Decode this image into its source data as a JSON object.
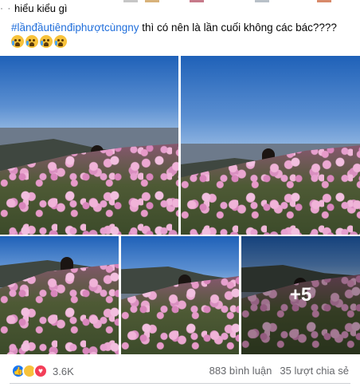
{
  "post": {
    "top_text": "hiểu kiểu gì",
    "hashtag": "#lầnđầutiênđiphượtcùngny",
    "caption": " thì có nên là lần cuối không các bác????",
    "emoji_names": [
      "crying-face",
      "crying-face",
      "crying-face",
      "crying-face"
    ],
    "more_photos_label": "+5"
  },
  "footer": {
    "reaction_count": "3.6K",
    "comments": "883 bình luận",
    "shares": "35 lượt chia sẻ",
    "reaction_icons": [
      "like-icon",
      "haha-icon",
      "love-icon"
    ]
  },
  "colors": {
    "hashtag": "#216fdb",
    "like": "#1877f2",
    "love": "#f33e58",
    "haha": "#f7c23b",
    "muted_text": "#65676b"
  }
}
